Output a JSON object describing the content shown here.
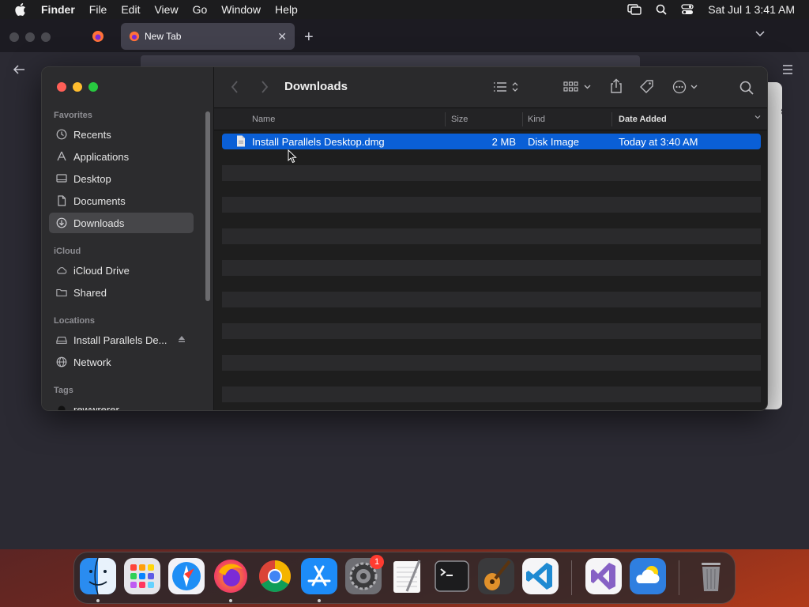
{
  "menubar": {
    "app_name": "Finder",
    "menus": [
      "File",
      "Edit",
      "View",
      "Go",
      "Window",
      "Help"
    ],
    "datetime": "Sat Jul 1  3:41 AM"
  },
  "browser": {
    "tab_title": "New Tab"
  },
  "finder": {
    "title": "Downloads",
    "sidebar": {
      "favorites_label": "Favorites",
      "favorites": [
        "Recents",
        "Applications",
        "Desktop",
        "Documents",
        "Downloads"
      ],
      "icloud_label": "iCloud",
      "icloud": [
        "iCloud Drive",
        "Shared"
      ],
      "locations_label": "Locations",
      "locations": [
        "Install Parallels De...",
        "Network"
      ],
      "tags_label": "Tags",
      "tags": [
        "rewwrerer"
      ],
      "selected": "Downloads"
    },
    "columns": {
      "name": "Name",
      "size": "Size",
      "kind": "Kind",
      "date_added": "Date Added"
    },
    "files": [
      {
        "name": "Install Parallels Desktop.dmg",
        "size": "2 MB",
        "kind": "Disk Image",
        "date_added": "Today at 3:40 AM",
        "selected": true
      }
    ]
  },
  "dock": {
    "apps": [
      "Finder",
      "Launchpad",
      "Safari",
      "Firefox",
      "Google Chrome",
      "App Store",
      "System Settings",
      "TextEdit",
      "Terminal",
      "GarageBand",
      "Visual Studio Code",
      "Visual Studio",
      "Weather",
      "Trash"
    ],
    "system_settings_badge": "1"
  },
  "colors": {
    "selection": "#0a5fd6",
    "close": "#ff5f57",
    "minimize": "#febc2e",
    "maximize": "#28c840"
  }
}
